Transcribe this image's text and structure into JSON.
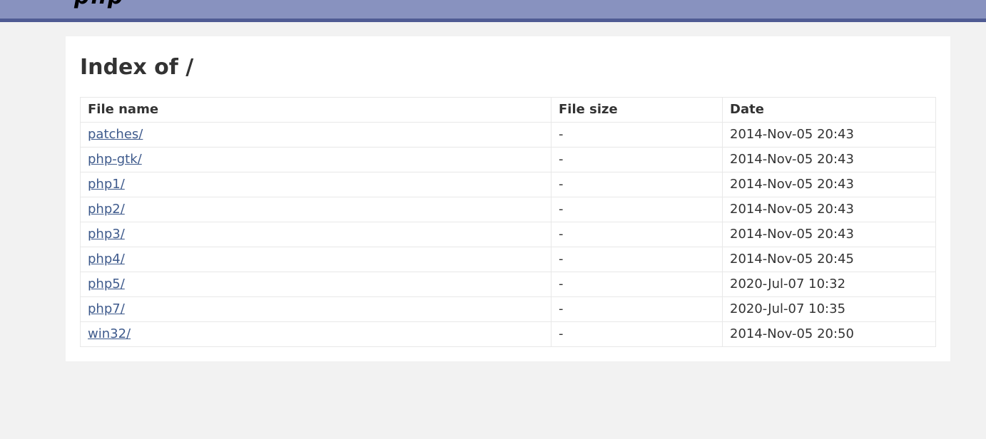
{
  "header": {
    "logo_fragment": "php"
  },
  "page_title": "Index of /",
  "table": {
    "headers": [
      "File name",
      "File size",
      "Date"
    ],
    "rows": [
      {
        "name": "patches/",
        "size": "-",
        "date": "2014-Nov-05 20:43"
      },
      {
        "name": "php-gtk/",
        "size": "-",
        "date": "2014-Nov-05 20:43"
      },
      {
        "name": "php1/",
        "size": "-",
        "date": "2014-Nov-05 20:43"
      },
      {
        "name": "php2/",
        "size": "-",
        "date": "2014-Nov-05 20:43"
      },
      {
        "name": "php3/",
        "size": "-",
        "date": "2014-Nov-05 20:43"
      },
      {
        "name": "php4/",
        "size": "-",
        "date": "2014-Nov-05 20:45"
      },
      {
        "name": "php5/",
        "size": "-",
        "date": "2020-Jul-07 10:32"
      },
      {
        "name": "php7/",
        "size": "-",
        "date": "2020-Jul-07 10:35"
      },
      {
        "name": "win32/",
        "size": "-",
        "date": "2014-Nov-05 20:50"
      }
    ]
  },
  "colors": {
    "header_bg": "#8892bf",
    "header_border": "#4f5b93",
    "link": "#3e5a8c",
    "page_bg": "#f2f2f2"
  }
}
